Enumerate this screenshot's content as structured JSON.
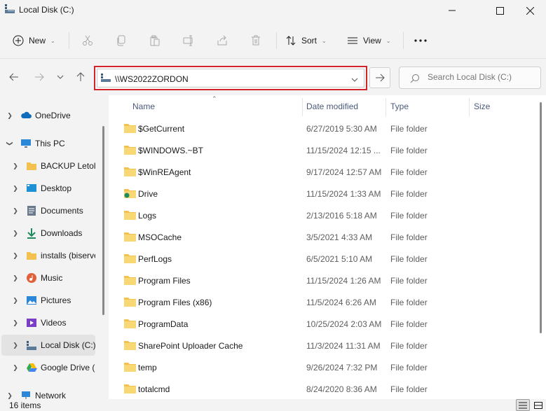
{
  "window": {
    "title": "Local Disk (C:)",
    "controls": [
      "minimize",
      "maximize",
      "close"
    ]
  },
  "toolbar": {
    "new_label": "New",
    "sort_label": "Sort",
    "view_label": "View",
    "icons": [
      "cut-icon",
      "copy-icon",
      "paste-icon",
      "rename-icon",
      "share-icon",
      "delete-icon",
      "more-icon"
    ]
  },
  "address": {
    "path": "\\\\WS2022ZORDON",
    "highlight_color": "#d2232a"
  },
  "search": {
    "placeholder": "Search Local Disk (C:)"
  },
  "sidebar": {
    "items": [
      {
        "label": "OneDrive",
        "icon": "cloud-icon",
        "color": "#0f6cbd"
      },
      {
        "label": "This PC",
        "icon": "monitor-icon",
        "color": "#2b88d8"
      },
      {
        "label": "BACKUP Letolte",
        "icon": "folder-icon",
        "color": "#f2c14e"
      },
      {
        "label": "Desktop",
        "icon": "desktop-icon",
        "color": "#1e90d6"
      },
      {
        "label": "Documents",
        "icon": "documents-icon",
        "color": "#6a7a8c"
      },
      {
        "label": "Downloads",
        "icon": "download-icon",
        "color": "#1f8a5b"
      },
      {
        "label": "installs (biserve",
        "icon": "folder-icon",
        "color": "#f2c14e"
      },
      {
        "label": "Music",
        "icon": "music-icon",
        "color": "#e0603a"
      },
      {
        "label": "Pictures",
        "icon": "pictures-icon",
        "color": "#2b88d8"
      },
      {
        "label": "Videos",
        "icon": "videos-icon",
        "color": "#7a3fc8"
      },
      {
        "label": "Local Disk (C:)",
        "icon": "drive-icon",
        "color": "#3a5a7a"
      },
      {
        "label": "Google Drive (G",
        "icon": "google-drive-icon",
        "color": "#34a853"
      },
      {
        "label": "Network",
        "icon": "network-icon",
        "color": "#2b88d8"
      }
    ],
    "selected_index": 10
  },
  "columns": {
    "name": "Name",
    "date": "Date modified",
    "type": "Type",
    "size": "Size"
  },
  "files": [
    {
      "name": "$GetCurrent",
      "date": "6/27/2019 5:30 AM",
      "type": "File folder",
      "icon": "folder-icon"
    },
    {
      "name": "$WINDOWS.~BT",
      "date": "11/15/2024 12:15 ...",
      "type": "File folder",
      "icon": "folder-icon"
    },
    {
      "name": "$WinREAgent",
      "date": "9/17/2024 12:57 AM",
      "type": "File folder",
      "icon": "folder-icon"
    },
    {
      "name": "Drive",
      "date": "11/15/2024 1:33 AM",
      "type": "File folder",
      "icon": "synced-folder-icon"
    },
    {
      "name": "Logs",
      "date": "2/13/2016 5:18 AM",
      "type": "File folder",
      "icon": "folder-icon"
    },
    {
      "name": "MSOCache",
      "date": "3/5/2021 4:33 AM",
      "type": "File folder",
      "icon": "folder-icon"
    },
    {
      "name": "PerfLogs",
      "date": "6/5/2021 5:10 AM",
      "type": "File folder",
      "icon": "folder-icon"
    },
    {
      "name": "Program Files",
      "date": "11/15/2024 1:26 AM",
      "type": "File folder",
      "icon": "folder-icon"
    },
    {
      "name": "Program Files (x86)",
      "date": "11/5/2024 6:26 AM",
      "type": "File folder",
      "icon": "folder-icon"
    },
    {
      "name": "ProgramData",
      "date": "10/25/2024 2:03 AM",
      "type": "File folder",
      "icon": "folder-icon"
    },
    {
      "name": "SharePoint Uploader Cache",
      "date": "11/3/2024 11:31 AM",
      "type": "File folder",
      "icon": "folder-icon"
    },
    {
      "name": "temp",
      "date": "9/26/2024 7:32 PM",
      "type": "File folder",
      "icon": "folder-icon"
    },
    {
      "name": "totalcmd",
      "date": "8/24/2020 8:36 AM",
      "type": "File folder",
      "icon": "folder-icon"
    }
  ],
  "status": {
    "item_count": "16 items"
  }
}
